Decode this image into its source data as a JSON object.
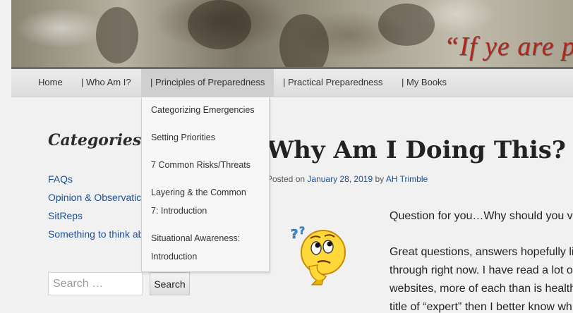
{
  "banner": {
    "quote": "“If ye are p"
  },
  "nav": {
    "items": [
      {
        "label": "Home"
      },
      {
        "label": "| Who Am I?"
      },
      {
        "label": "| Principles of Preparedness"
      },
      {
        "label": "| Practical Preparedness"
      },
      {
        "label": "| My Books"
      }
    ],
    "active_index": 2
  },
  "dropdown": {
    "items": [
      {
        "line1": "Categorizing Emergencies",
        "line2": ""
      },
      {
        "line1": "Setting Priorities",
        "line2": ""
      },
      {
        "line1": "7 Common Risks/Threats",
        "line2": ""
      },
      {
        "line1": "Layering & the Common",
        "line2": "7: Introduction"
      },
      {
        "line1": "Situational Awareness:",
        "line2": "Introduction"
      }
    ]
  },
  "sidebar": {
    "heading": "Categories",
    "links": [
      {
        "label": "FAQs"
      },
      {
        "label": "Opinion & Observatic"
      },
      {
        "label": "SitReps"
      },
      {
        "label": "Something to think ab"
      }
    ],
    "search": {
      "placeholder": "Search …",
      "button_label": "Search"
    }
  },
  "post": {
    "title": "Why Am I Doing This?",
    "meta_prefix": "Posted on",
    "date": "January 28, 2019",
    "by": "by",
    "author": "AH Trimble",
    "paragraph1": "Question for you…Why should you v",
    "paragraph2_lines": [
      "Great questions, answers hopefully li",
      "through right now. I have read a lot o",
      "websites, more of each than is health",
      "title of “expert” then I better know wh"
    ]
  },
  "colors": {
    "link": "#1e4f91",
    "quote_red": "#b3261e",
    "nav_bg": "#e4e4e4"
  },
  "icons": {
    "thinking": "thinking-face-icon"
  }
}
